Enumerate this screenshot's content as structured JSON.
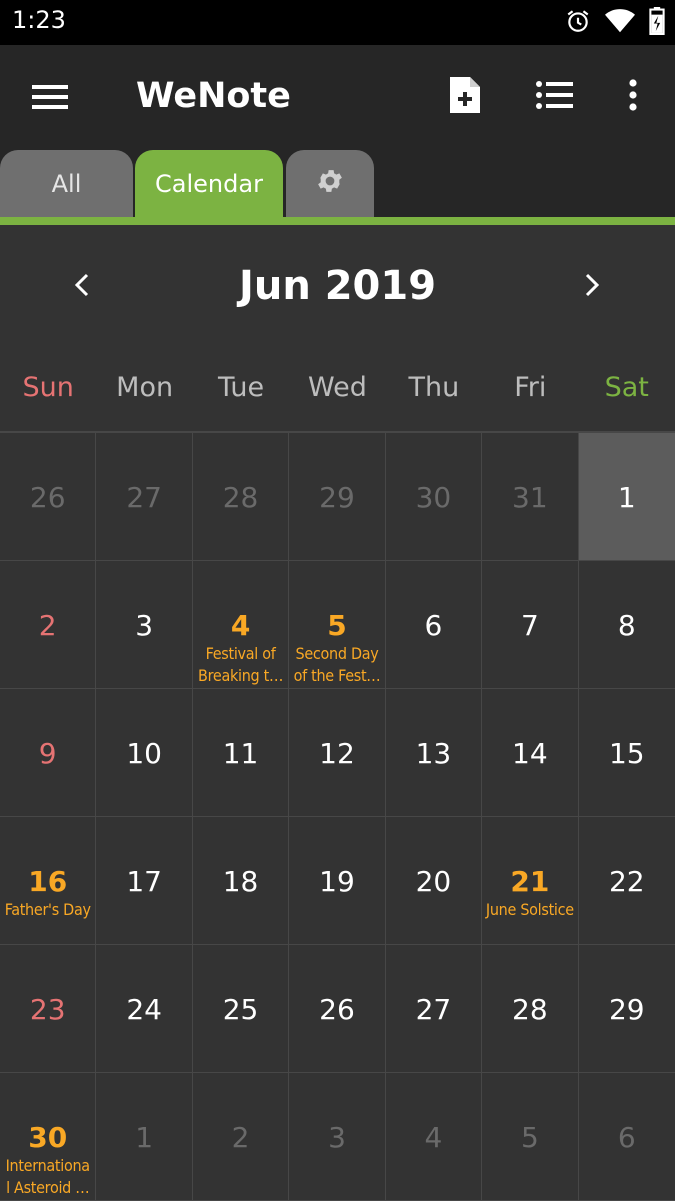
{
  "status_bar": {
    "time": "1:23",
    "icons": [
      "alarm-icon",
      "wifi-icon",
      "battery-charging-icon"
    ]
  },
  "app_bar": {
    "title": "WeNote",
    "actions": [
      "new-note-icon",
      "list-view-icon",
      "more-vert-icon"
    ]
  },
  "tabs": [
    {
      "label": "All",
      "active": false
    },
    {
      "label": "Calendar",
      "active": true
    },
    {
      "label": "",
      "icon": "gear-icon",
      "active": false
    }
  ],
  "calendar": {
    "month_title": "Jun 2019",
    "weekdays": [
      "Sun",
      "Mon",
      "Tue",
      "Wed",
      "Thu",
      "Fri",
      "Sat"
    ],
    "days": [
      {
        "day": "26",
        "other": true
      },
      {
        "day": "27",
        "other": true
      },
      {
        "day": "28",
        "other": true
      },
      {
        "day": "29",
        "other": true
      },
      {
        "day": "30",
        "other": true
      },
      {
        "day": "31",
        "other": true
      },
      {
        "day": "1",
        "selected": true
      },
      {
        "day": "2",
        "sunday": true
      },
      {
        "day": "3"
      },
      {
        "day": "4",
        "event": "Festival of Breaking t…",
        "holiday": true
      },
      {
        "day": "5",
        "event": "Second Day of the Fest…",
        "holiday": true
      },
      {
        "day": "6"
      },
      {
        "day": "7"
      },
      {
        "day": "8"
      },
      {
        "day": "9",
        "sunday": true
      },
      {
        "day": "10"
      },
      {
        "day": "11"
      },
      {
        "day": "12"
      },
      {
        "day": "13"
      },
      {
        "day": "14"
      },
      {
        "day": "15"
      },
      {
        "day": "16",
        "event": "Father's Day",
        "holiday": true
      },
      {
        "day": "17"
      },
      {
        "day": "18"
      },
      {
        "day": "19"
      },
      {
        "day": "20"
      },
      {
        "day": "21",
        "event": "June Solstice",
        "holiday": true
      },
      {
        "day": "22"
      },
      {
        "day": "23",
        "sunday": true
      },
      {
        "day": "24"
      },
      {
        "day": "25"
      },
      {
        "day": "26"
      },
      {
        "day": "27"
      },
      {
        "day": "28"
      },
      {
        "day": "29"
      },
      {
        "day": "30",
        "event": "Internationa l Asteroid …",
        "holiday": true
      },
      {
        "day": "1",
        "other": true
      },
      {
        "day": "2",
        "other": true
      },
      {
        "day": "3",
        "other": true
      },
      {
        "day": "4",
        "other": true
      },
      {
        "day": "5",
        "other": true
      },
      {
        "day": "6",
        "other": true
      }
    ]
  },
  "colors": {
    "accent": "#7cb342",
    "holiday": "#f9a825",
    "sunday": "#e57373",
    "background": "#333333"
  }
}
